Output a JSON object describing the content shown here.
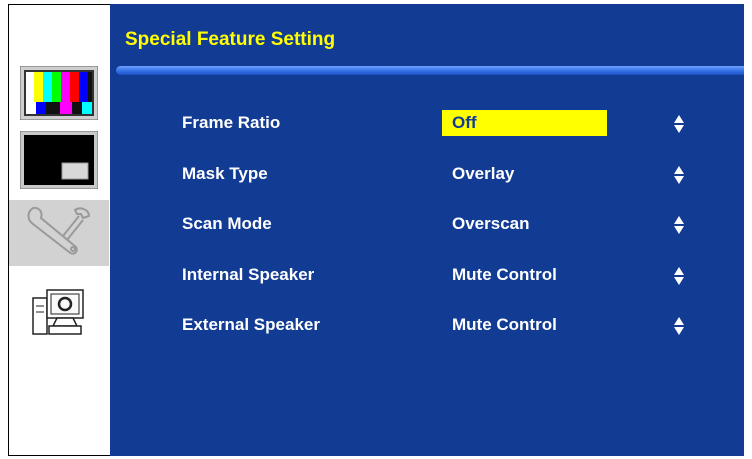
{
  "menu": {
    "title": "Special Feature Setting",
    "title_color": "#ffff00",
    "background_color": "#123b94",
    "selected_color": "#ffff00"
  },
  "sidebar": {
    "tabs": [
      {
        "icon": "color-bars-icon",
        "active": false
      },
      {
        "icon": "picture-in-picture-icon",
        "active": false
      },
      {
        "icon": "wrench-tools-icon",
        "active": true
      },
      {
        "icon": "computer-system-icon",
        "active": false
      }
    ]
  },
  "settings": [
    {
      "label": "Frame Ratio",
      "value": "Off",
      "selected": true
    },
    {
      "label": "Mask Type",
      "value": "Overlay",
      "selected": false
    },
    {
      "label": "Scan Mode",
      "value": "Overscan",
      "selected": false
    },
    {
      "label": "Internal Speaker",
      "value": "Mute Control",
      "selected": false
    },
    {
      "label": "External Speaker",
      "value": "Mute Control",
      "selected": false
    }
  ]
}
